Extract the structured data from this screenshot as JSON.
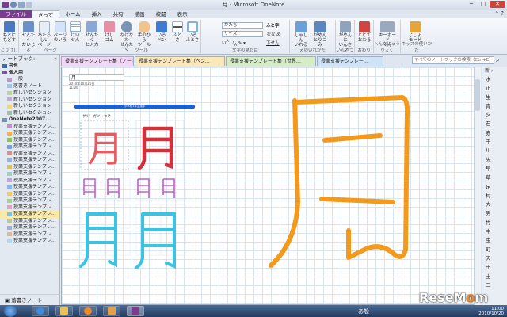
{
  "window": {
    "title": "月 - Microsoft OneNote",
    "controls": [
      "─",
      "□",
      "✕"
    ]
  },
  "ribbon_tabs": [
    "ファイル",
    "きっず",
    "ホーム",
    "挿入",
    "共有",
    "描画",
    "校閲",
    "表示"
  ],
  "ribbon_buttons": [
    {
      "label": "もとに\nもどす",
      "icon": "undo-icon",
      "color": "#4a78c2"
    },
    {
      "label": "せんたく\nかいじょ",
      "icon": "select-icon",
      "color": "#6b8fc9"
    },
    {
      "label": "あたらしい\nページ",
      "icon": "new-page-icon",
      "color": "#e9eef6"
    },
    {
      "label": "ページ\nのいろ",
      "icon": "page-color-icon",
      "color": "#d4e3f7"
    },
    {
      "label": "けい\nせん",
      "icon": "rule-lines-icon",
      "color": "#cfdcec"
    },
    {
      "label": "せんたく\nと入力",
      "icon": "select-type-icon",
      "color": "#8aa8d6"
    },
    {
      "label": "けし\nゴム",
      "icon": "eraser-icon",
      "color": "#e88fa6"
    },
    {
      "label": "なげなわ\nせんたく",
      "icon": "lasso-icon",
      "color": "#7c93b8"
    },
    {
      "label": "手のひら\nツール",
      "icon": "hand-tool-icon",
      "color": "#f0c48d"
    },
    {
      "label": "いろ\nペン",
      "icon": "color-pen-icon",
      "color": "#3f7bd3"
    },
    {
      "label": "ふと\nさ",
      "icon": "pen-width-icon",
      "color": "#555555"
    },
    {
      "label": "いろ\nふとさ",
      "icon": "color-width-icon",
      "color": "#7fb3e8"
    },
    {
      "label": "しゃしん\nいれる",
      "icon": "insert-photo-icon",
      "color": "#6aa0d8"
    },
    {
      "label": "がめん\nとりこみ",
      "icon": "screen-clip-icon",
      "color": "#5a86c1"
    },
    {
      "label": "がめんに\nいんさつ",
      "icon": "print-screen-icon",
      "color": "#8fa3bd"
    },
    {
      "label": "とじて\nおわる",
      "icon": "close-exit-icon",
      "color": "#d0453f"
    },
    {
      "label": "キーボード\nくん",
      "icon": "keyboard-icon",
      "color": "#9aa9bd"
    },
    {
      "label": "じしょ\nモード",
      "icon": "dictionary-icon",
      "color": "#e4a63a"
    }
  ],
  "font_controls": {
    "font_name": "かたち",
    "font_size": "サイズ",
    "bold_label": "ふと字",
    "strike_label": "なな め",
    "underline_label": "下せん"
  },
  "ribbon_groups": [
    "とりけし",
    "ページ",
    "ツール",
    "文字の見た目",
    "えのいれかた",
    "いんさつ",
    "おわり",
    "へんなにゅうりょく",
    "キッズの使いかた"
  ],
  "nav": {
    "heading": "ノートブック:",
    "items": [
      {
        "label": "共有",
        "swatch": "#3a6fb7",
        "type": "notebook"
      },
      {
        "label": "個人用",
        "swatch": "#7c4fa3",
        "type": "notebook"
      },
      {
        "label": "一般",
        "swatch": "#b79ad0",
        "type": "section"
      },
      {
        "label": "落書きノート",
        "swatch": "#9fc5ea",
        "type": "section"
      },
      {
        "label": "新しいセクション",
        "swatch": "#b8d88f",
        "type": "section"
      },
      {
        "label": "新しいセクション",
        "swatch": "#c8a6df",
        "type": "section"
      },
      {
        "label": "新しいセクション",
        "swatch": "#f5d47f",
        "type": "section"
      },
      {
        "label": "新しいセクション",
        "swatch": "#9bc2a4",
        "type": "section"
      },
      {
        "label": "OneNote2007...",
        "swatch": "#6e8fbf",
        "type": "notebook"
      },
      {
        "label": "授業支援テンプレ…",
        "swatch": "#c78ad9",
        "type": "section"
      },
      {
        "label": "授業支援テンプレ…",
        "swatch": "#f0b24d",
        "type": "section"
      },
      {
        "label": "授業支援テンプレ…",
        "swatch": "#8bc35c",
        "type": "section"
      },
      {
        "label": "授業支援テンプレ…",
        "swatch": "#6aa8e8",
        "type": "section"
      },
      {
        "label": "授業支援テンプレ…",
        "swatch": "#e88a8a",
        "type": "section"
      },
      {
        "label": "授業支援テンプレ…",
        "swatch": "#93b3dc",
        "type": "section"
      },
      {
        "label": "授業支援テンプレ…",
        "swatch": "#d8c06b",
        "type": "section"
      },
      {
        "label": "授業支援テンプレ…",
        "swatch": "#9bd0c4",
        "type": "section"
      },
      {
        "label": "授業支援テンプレ…",
        "swatch": "#c4a2e2",
        "type": "section"
      },
      {
        "label": "授業支援テンプレ…",
        "swatch": "#82b8ee",
        "type": "section"
      },
      {
        "label": "授業支援テンプレ…",
        "swatch": "#f3c870",
        "type": "section"
      },
      {
        "label": "授業支援テンプレ…",
        "swatch": "#a4d28a",
        "type": "section"
      },
      {
        "label": "授業支援テンプレ…",
        "swatch": "#e8a0c5",
        "type": "section"
      },
      {
        "label": "授業支援テンプレ…",
        "swatch": "#84c0e0",
        "type": "section",
        "selected": true
      },
      {
        "label": "授業支援テンプレ…",
        "swatch": "#bfc98a",
        "type": "section"
      },
      {
        "label": "授業支援テンプレ…",
        "swatch": "#9cb0d9",
        "type": "section"
      },
      {
        "label": "授業支援テンプレ…",
        "swatch": "#e5b58e",
        "type": "section"
      },
      {
        "label": "授業支援テンプレ…",
        "swatch": "#b0d6f0",
        "type": "section"
      }
    ],
    "footer": "落書きノート"
  },
  "section_tabs": [
    {
      "label": "授業支援テンプレート集（ノート）",
      "color": "#f2d6f5"
    },
    {
      "label": "授業支援テンプレート集（ペン…",
      "color": "#fbe8b8"
    },
    {
      "label": "授業支援テンプレート集（世界…",
      "color": "#d6ecc4"
    },
    {
      "label": "授業支援テンプレー…",
      "color": "#cfe3f7",
      "active": true
    }
  ],
  "search_placeholder": "すべてのノートブックの検索（Ctrl+E）",
  "page": {
    "title": "月",
    "date": "2010年10月20日",
    "time": "11:00"
  },
  "worksheet": {
    "banner": "小学校1年生漢字",
    "reading": "ゲツ・ガツ・つき",
    "big_char": "月"
  },
  "page_list": {
    "heading": "新",
    "items": [
      "水",
      "正",
      "生",
      "青",
      "夕",
      "石",
      "赤",
      "千",
      "川",
      "先",
      "早",
      "草",
      "足",
      "村",
      "大",
      "男",
      "竹",
      "中",
      "虫",
      "町",
      "天",
      "田",
      "土",
      "二"
    ],
    "selected_index": -1
  },
  "taskbar": {
    "ime": "あ般",
    "clock_time": "11:00",
    "clock_date": "2010/10/20"
  },
  "watermark": {
    "part1": "Rese",
    "part2": "M",
    "part3": "o",
    "part4": "m"
  }
}
